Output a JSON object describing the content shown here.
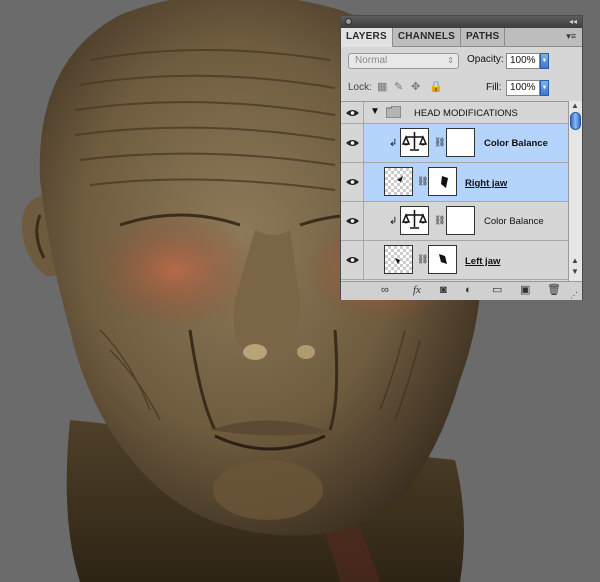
{
  "panel": {
    "tabs": [
      {
        "label": "LAYERS",
        "active": true
      },
      {
        "label": "CHANNELS",
        "active": false
      },
      {
        "label": "PATHS",
        "active": false
      }
    ],
    "blend_mode": "Normal",
    "opacity_label": "Opacity:",
    "opacity_value": "100%",
    "lock_label": "Lock:",
    "fill_label": "Fill:",
    "fill_value": "100%"
  },
  "layers": [
    {
      "name": "HEAD MODIFICATIONS",
      "type": "group",
      "selected": false,
      "visible": true
    },
    {
      "name": "Color Balance",
      "type": "adjustment",
      "selected": true,
      "clipped": true,
      "visible": true
    },
    {
      "name": "Right jaw",
      "type": "pixel-with-mask",
      "selected": true,
      "visible": true
    },
    {
      "name": "Color Balance",
      "type": "adjustment",
      "selected": false,
      "clipped": true,
      "visible": true
    },
    {
      "name": "Left jaw",
      "type": "pixel-with-mask",
      "selected": false,
      "visible": true
    }
  ],
  "footer_icons": [
    "link-icon",
    "fx-icon",
    "mask-icon",
    "adjustment-icon",
    "group-folder-icon",
    "new-layer-icon",
    "trash-icon"
  ],
  "colors": {
    "background": "#6b6b6b",
    "selection": "#b5d4fb",
    "accent": "#3b78d0"
  }
}
